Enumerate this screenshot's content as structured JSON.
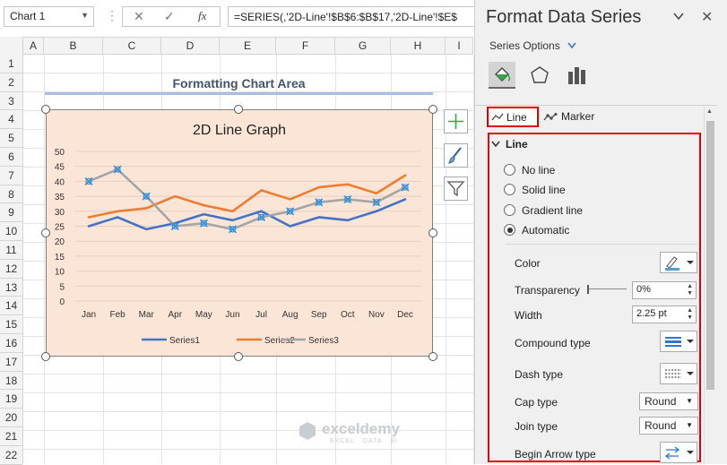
{
  "formula_bar": {
    "name_box": "Chart 1",
    "cancel_symbol": "✕",
    "enter_symbol": "✓",
    "fx_label": "fx",
    "formula": "=SERIES(,'2D-Line'!$B$6:$B$17,'2D-Line'!$E$"
  },
  "columns": [
    "A",
    "B",
    "C",
    "D",
    "E",
    "F",
    "G",
    "H",
    "I"
  ],
  "rows": [
    "1",
    "2",
    "3",
    "4",
    "5",
    "6",
    "7",
    "8",
    "9",
    "10",
    "11",
    "12",
    "13",
    "14",
    "15",
    "16",
    "17",
    "18",
    "19",
    "20",
    "21",
    "22"
  ],
  "sheet_title": "Formatting Chart Area",
  "chart_data": {
    "type": "line",
    "title": "2D Line Graph",
    "categories": [
      "Jan",
      "Feb",
      "Mar",
      "Apr",
      "May",
      "Jun",
      "Jul",
      "Aug",
      "Sep",
      "Oct",
      "Nov",
      "Dec"
    ],
    "ylim": [
      0,
      50
    ],
    "yticks": [
      "0",
      "5",
      "10",
      "15",
      "20",
      "25",
      "30",
      "35",
      "40",
      "45",
      "50"
    ],
    "grid": true,
    "legend_position": "bottom",
    "series": [
      {
        "name": "Series1",
        "color": "#4472c4",
        "values": [
          25,
          28,
          24,
          26,
          29,
          27,
          30,
          25,
          28,
          27,
          30,
          34
        ]
      },
      {
        "name": "Series2",
        "color": "#ed7d31",
        "values": [
          28,
          30,
          31,
          35,
          32,
          30,
          37,
          34,
          38,
          39,
          36,
          42
        ]
      },
      {
        "name": "Series3",
        "color": "#a5a5a5",
        "selected": true,
        "values": [
          40,
          44,
          35,
          25,
          26,
          24,
          28,
          30,
          33,
          34,
          33,
          38
        ]
      }
    ]
  },
  "watermark": {
    "brand": "exceldemy",
    "tagline": "EXCEL · DATA · BI"
  },
  "panel": {
    "title": "Format Data Series",
    "series_options_label": "Series Options",
    "tabs": [
      "Line",
      "Marker"
    ],
    "section_title": "Line",
    "line_options": [
      "No line",
      "Solid line",
      "Gradient line",
      "Automatic"
    ],
    "selected_line_option": "Automatic",
    "color_label": "Color",
    "transparency_label": "Transparency",
    "transparency_value": "0%",
    "width_label": "Width",
    "width_value": "2.25 pt",
    "compound_label": "Compound type",
    "dash_label": "Dash type",
    "cap_label": "Cap type",
    "cap_value": "Round",
    "join_label": "Join type",
    "join_value": "Round",
    "begin_arrow_label": "Begin Arrow type",
    "highlight_color": "#e00000"
  }
}
